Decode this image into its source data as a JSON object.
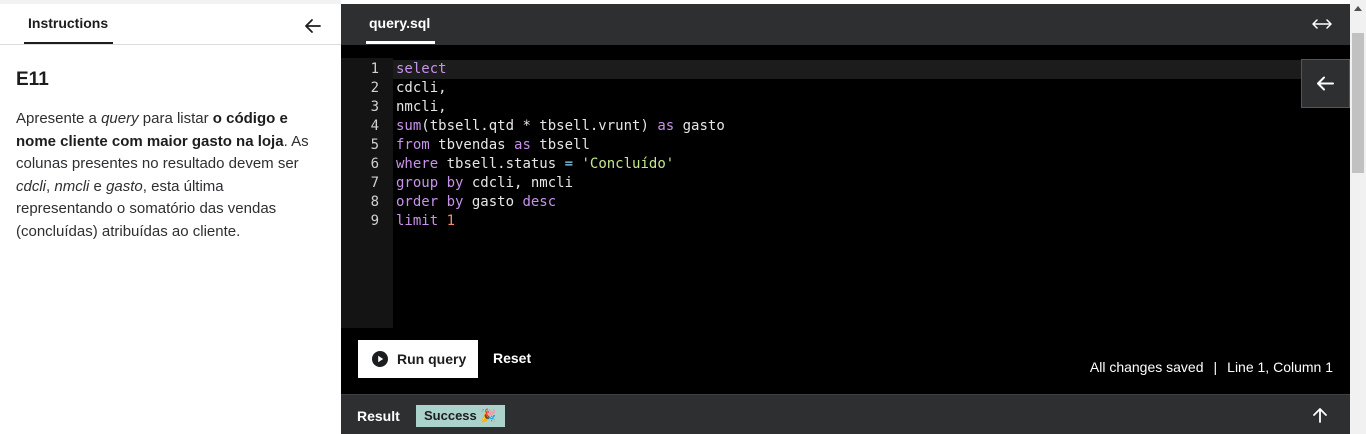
{
  "left_panel": {
    "tab_label": "Instructions",
    "exercise_title": "E11",
    "paragraph": {
      "p1": "Apresente a ",
      "p2": "query",
      "p3": " para listar ",
      "p4": "o código e nome cliente com maior gasto na loja",
      "p5": ". As colunas presentes no resultado devem ser ",
      "p6": "cdcli",
      "p7": ", ",
      "p8": "nmcli",
      "p9": " e ",
      "p10": "gasto",
      "p11": ", esta última representando o somatório das vendas (concluídas) atribuídas ao cliente."
    }
  },
  "editor": {
    "file_tab": "query.sql",
    "code_lines": [
      {
        "n": "1",
        "tokens": [
          {
            "t": "select",
            "c": "kw"
          }
        ]
      },
      {
        "n": "2",
        "tokens": [
          {
            "t": "cdcli,",
            "c": ""
          }
        ]
      },
      {
        "n": "3",
        "tokens": [
          {
            "t": "nmcli,",
            "c": ""
          }
        ]
      },
      {
        "n": "4",
        "tokens": [
          {
            "t": "sum",
            "c": "fn"
          },
          {
            "t": "(tbsell.qtd * tbsell.vrunt) ",
            "c": ""
          },
          {
            "t": "as",
            "c": "kw"
          },
          {
            "t": " gasto",
            "c": ""
          }
        ]
      },
      {
        "n": "5",
        "tokens": [
          {
            "t": "from",
            "c": "kw"
          },
          {
            "t": " tbvendas ",
            "c": ""
          },
          {
            "t": "as",
            "c": "kw"
          },
          {
            "t": " tbsell",
            "c": ""
          }
        ]
      },
      {
        "n": "6",
        "tokens": [
          {
            "t": "where",
            "c": "kw"
          },
          {
            "t": " tbsell.status ",
            "c": ""
          },
          {
            "t": "=",
            "c": "op"
          },
          {
            "t": " ",
            "c": ""
          },
          {
            "t": "'Concluído'",
            "c": "str"
          }
        ]
      },
      {
        "n": "7",
        "tokens": [
          {
            "t": "group by",
            "c": "kw"
          },
          {
            "t": " cdcli, nmcli",
            "c": ""
          }
        ]
      },
      {
        "n": "8",
        "tokens": [
          {
            "t": "order by",
            "c": "kw"
          },
          {
            "t": " gasto ",
            "c": ""
          },
          {
            "t": "desc",
            "c": "kw"
          }
        ]
      },
      {
        "n": "9",
        "tokens": [
          {
            "t": "limit",
            "c": "kw"
          },
          {
            "t": " ",
            "c": ""
          },
          {
            "t": "1",
            "c": "num"
          }
        ]
      }
    ],
    "run_label": "Run query",
    "reset_label": "Reset",
    "save_status": "All changes saved",
    "separator": "|",
    "cursor_position": "Line 1, Column 1"
  },
  "result": {
    "label": "Result",
    "badge": "Success 🎉"
  },
  "icons": {
    "collapse_left": "arrow-left-icon",
    "expand": "expand-horizontal-icon",
    "side_collapse": "arrow-left-icon",
    "run": "play-circle-icon",
    "result_toggle": "arrow-up-icon"
  },
  "colors": {
    "keyword": "#c792ea",
    "string": "#c3e88d",
    "number": "#f78c6c",
    "success_badge": "#acd2cc",
    "editor_bg": "#000000",
    "bar_bg": "#2d2f31"
  }
}
